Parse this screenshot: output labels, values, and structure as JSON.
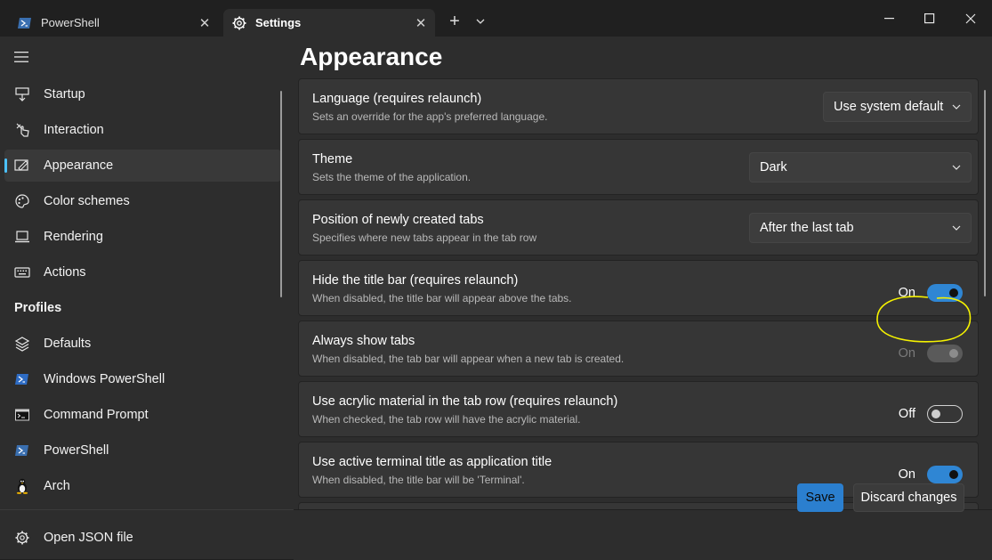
{
  "colors": {
    "accent": "#2f86d4",
    "highlight": "#f5f200",
    "window_bg": "#202020",
    "content_bg": "#2d2d2d"
  },
  "tabs": [
    {
      "label": "PowerShell",
      "icon": "powershell-icon",
      "close": "✕"
    },
    {
      "label": "Settings",
      "icon": "gear-icon",
      "close": "✕"
    }
  ],
  "titlebar": {
    "new_tab": "+"
  },
  "sidebar": {
    "items": [
      {
        "label": "Startup",
        "icon": "startup-icon"
      },
      {
        "label": "Interaction",
        "icon": "interaction-icon"
      },
      {
        "label": "Appearance",
        "icon": "appearance-icon",
        "selected": true
      },
      {
        "label": "Color schemes",
        "icon": "palette-icon"
      },
      {
        "label": "Rendering",
        "icon": "monitor-icon"
      },
      {
        "label": "Actions",
        "icon": "keyboard-icon"
      }
    ],
    "profiles_header": "Profiles",
    "profiles": [
      {
        "label": "Defaults",
        "icon": "layers-icon"
      },
      {
        "label": "Windows PowerShell",
        "icon": "powershell-icon"
      },
      {
        "label": "Command Prompt",
        "icon": "cmd-icon"
      },
      {
        "label": "PowerShell",
        "icon": "powershell-icon"
      },
      {
        "label": "Arch",
        "icon": "linux-icon"
      }
    ],
    "open_json": "Open JSON file"
  },
  "page": {
    "title": "Appearance"
  },
  "settings": [
    {
      "title": "Language (requires relaunch)",
      "desc": "Sets an override for the app's preferred language.",
      "control": "combo",
      "value": "Use system default"
    },
    {
      "title": "Theme",
      "desc": "Sets the theme of the application.",
      "control": "combo",
      "value": "Dark"
    },
    {
      "title": "Position of newly created tabs",
      "desc": "Specifies where new tabs appear in the tab row",
      "control": "combo",
      "value": "After the last tab"
    },
    {
      "title": "Hide the title bar (requires relaunch)",
      "desc": "When disabled, the title bar will appear above the tabs.",
      "control": "toggle",
      "state": "On",
      "checked": true
    },
    {
      "title": "Always show tabs",
      "desc": "When disabled, the tab bar will appear when a new tab is created.",
      "control": "toggle",
      "state": "On",
      "checked": true,
      "disabled": true
    },
    {
      "title": "Use acrylic material in the tab row (requires relaunch)",
      "desc": "When checked, the tab row will have the acrylic material.",
      "control": "toggle",
      "state": "Off",
      "checked": false
    },
    {
      "title": "Use active terminal title as application title",
      "desc": "When disabled, the title bar will be 'Terminal'.",
      "control": "toggle",
      "state": "On",
      "checked": true
    }
  ],
  "footer": {
    "save": "Save",
    "discard": "Discard changes"
  }
}
